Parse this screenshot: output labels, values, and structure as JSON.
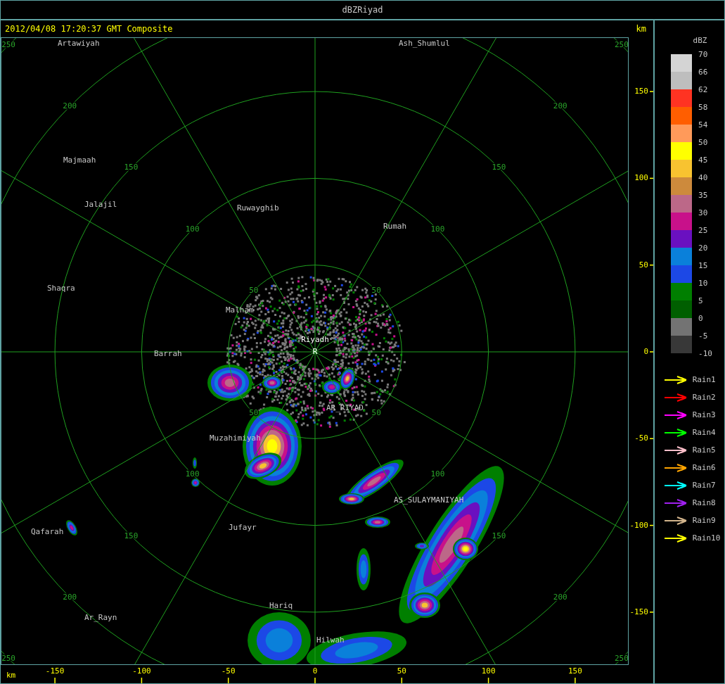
{
  "window": {
    "title": "dBZRiyad"
  },
  "header": {
    "timestamp": "2012/04/08 17:20:37 GMT Composite",
    "unit": "km"
  },
  "map": {
    "range_rings": [
      {
        "labels": [
          "50",
          "50",
          "50",
          "50"
        ]
      },
      {
        "labels": [
          "100",
          "100",
          "100",
          "100"
        ]
      },
      {
        "labels": [
          "150",
          "150",
          "150",
          "150"
        ]
      },
      {
        "labels": [
          "200",
          "200",
          "200",
          "200"
        ]
      },
      {
        "labels": [
          "250",
          "250",
          "250",
          "250"
        ]
      }
    ],
    "radar_site": {
      "name": "Riyadh",
      "marker": "R"
    },
    "places": [
      {
        "name": "Artawiyah"
      },
      {
        "name": "Ash_Shumlul"
      },
      {
        "name": "Majmaah"
      },
      {
        "name": "Jalajil"
      },
      {
        "name": "Ruwayghib"
      },
      {
        "name": "Rumah"
      },
      {
        "name": "Shaqra"
      },
      {
        "name": "Malham"
      },
      {
        "name": "Barrah"
      },
      {
        "name": "AR_RIYAD"
      },
      {
        "name": "Muzahimiyah"
      },
      {
        "name": "AS_SULAYMANIYAH"
      },
      {
        "name": "Qafarah"
      },
      {
        "name": "Jufayr"
      },
      {
        "name": "Hariq"
      },
      {
        "name": "Ar_Rayn"
      },
      {
        "name": "Hilwah"
      }
    ]
  },
  "y_axis": {
    "ticks": [
      "150",
      "100",
      "50",
      "0",
      "-50",
      "-100",
      "-150"
    ]
  },
  "x_axis": {
    "unit": "km",
    "ticks": [
      "-150",
      "-100",
      "-50",
      "0",
      "50",
      "100",
      "150"
    ]
  },
  "legend": {
    "title": "dBZ",
    "bins": [
      {
        "color": "#d4d4d4"
      },
      {
        "color": "#bebebe"
      },
      {
        "color": "#ff3322"
      },
      {
        "color": "#ff5e00"
      },
      {
        "color": "#ff9a5a"
      },
      {
        "color": "#ffff00"
      },
      {
        "color": "#f8c330"
      },
      {
        "color": "#cd8a3c"
      },
      {
        "color": "#bc6888"
      },
      {
        "color": "#c8118a"
      },
      {
        "color": "#6a10c0"
      },
      {
        "color": "#0a80da"
      },
      {
        "color": "#1c48e6"
      },
      {
        "color": "#007f00"
      },
      {
        "color": "#005f00"
      },
      {
        "color": "#737373"
      },
      {
        "color": "#383838"
      }
    ],
    "scale_labels": [
      "70",
      "66",
      "62",
      "58",
      "54",
      "50",
      "45",
      "40",
      "35",
      "30",
      "25",
      "20",
      "15",
      "10",
      "5",
      "0",
      "-5",
      "-10"
    ]
  },
  "tracks": [
    {
      "label": "Rain1",
      "color": "#ffff00"
    },
    {
      "label": "Rain2",
      "color": "#ff0000"
    },
    {
      "label": "Rain3",
      "color": "#ff00ff"
    },
    {
      "label": "Rain4",
      "color": "#00ff00"
    },
    {
      "label": "Rain5",
      "color": "#ffc0cb"
    },
    {
      "label": "Rain6",
      "color": "#ffa500"
    },
    {
      "label": "Rain7",
      "color": "#00ffff"
    },
    {
      "label": "Rain8",
      "color": "#a020f0"
    },
    {
      "label": "Rain9",
      "color": "#d2b48c"
    },
    {
      "label": "Rain10",
      "color": "#ffff00"
    }
  ]
}
